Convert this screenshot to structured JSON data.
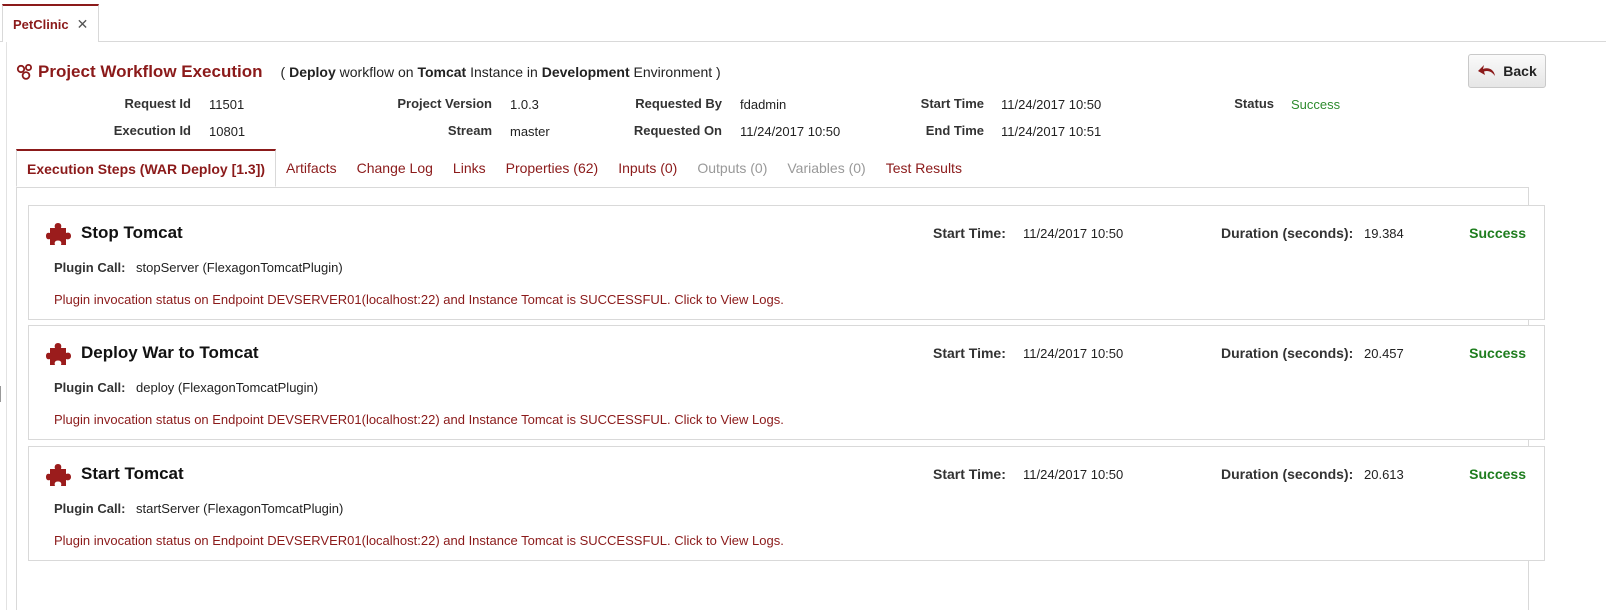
{
  "doc_tab": {
    "label": "PetClinic",
    "close": "✕"
  },
  "header": {
    "title": "Project Workflow Execution",
    "subtitle": {
      "open": "(",
      "workflow": "Deploy",
      "t1": "workflow on",
      "instance": "Tomcat",
      "t2": "Instance in",
      "environment": "Development",
      "t3": "Environment )"
    },
    "back_label": "Back"
  },
  "meta": {
    "request_id_label": "Request Id",
    "request_id": "11501",
    "execution_id_label": "Execution Id",
    "execution_id": "10801",
    "project_version_label": "Project Version",
    "project_version": "1.0.3",
    "stream_label": "Stream",
    "stream": "master",
    "requested_by_label": "Requested By",
    "requested_by": "fdadmin",
    "requested_on_label": "Requested On",
    "requested_on": "11/24/2017 10:50",
    "start_time_label": "Start Time",
    "start_time": "11/24/2017 10:50",
    "end_time_label": "End Time",
    "end_time": "11/24/2017 10:51",
    "status_label": "Status",
    "status": "Success"
  },
  "tabs": [
    {
      "label": "Execution Steps (WAR Deploy [1.3])",
      "state": "active"
    },
    {
      "label": "Artifacts",
      "state": "enabled"
    },
    {
      "label": "Change Log",
      "state": "enabled"
    },
    {
      "label": "Links",
      "state": "enabled"
    },
    {
      "label": "Properties (62)",
      "state": "enabled"
    },
    {
      "label": "Inputs (0)",
      "state": "enabled"
    },
    {
      "label": "Outputs (0)",
      "state": "disabled"
    },
    {
      "label": "Variables (0)",
      "state": "disabled"
    },
    {
      "label": "Test Results",
      "state": "enabled"
    }
  ],
  "step_labels": {
    "start_time": "Start Time:",
    "duration": "Duration (seconds):",
    "plugin_call": "Plugin Call:"
  },
  "steps": [
    {
      "name": "Stop Tomcat",
      "start_time": "11/24/2017 10:50",
      "duration": "19.384",
      "status": "Success",
      "plugin_call": "stopServer (FlexagonTomcatPlugin)",
      "message": "Plugin invocation status on Endpoint DEVSERVER01(localhost:22) and Instance Tomcat is SUCCESSFUL. Click to View Logs."
    },
    {
      "name": "Deploy War to Tomcat",
      "start_time": "11/24/2017 10:50",
      "duration": "20.457",
      "status": "Success",
      "plugin_call": "deploy (FlexagonTomcatPlugin)",
      "message": "Plugin invocation status on Endpoint DEVSERVER01(localhost:22) and Instance Tomcat is SUCCESSFUL. Click to View Logs."
    },
    {
      "name": "Start Tomcat",
      "start_time": "11/24/2017 10:50",
      "duration": "20.613",
      "status": "Success",
      "plugin_call": "startServer (FlexagonTomcatPlugin)",
      "message": "Plugin invocation status on Endpoint DEVSERVER01(localhost:22) and Instance Tomcat is SUCCESSFUL. Click to View Logs."
    }
  ],
  "icons": {
    "title": "workflow-icon",
    "back": "undo-arrow-icon",
    "step": "puzzle-piece-icon",
    "close": "close-icon"
  },
  "colors": {
    "brand": "#8b1a1a",
    "success": "#1e7d1e",
    "disabled": "#999999"
  }
}
